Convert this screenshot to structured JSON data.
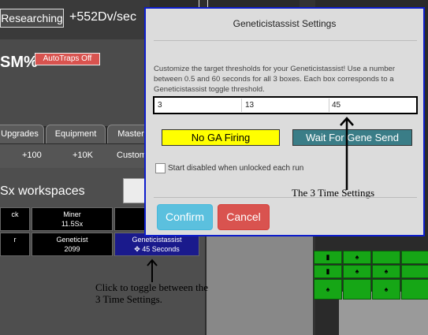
{
  "game": {
    "research_label": "Researching",
    "dv_rate": "+552Dv/sec",
    "sm_percent": "SM%",
    "autotraps_label": "AutoTraps Off",
    "tabs": [
      {
        "label": "Upgrades"
      },
      {
        "label": "Equipment"
      },
      {
        "label": "Master"
      }
    ],
    "buy_amounts": [
      {
        "label": "+100"
      },
      {
        "label": "+10K"
      },
      {
        "label": "Custom"
      }
    ],
    "workspace_title": "Sx workspaces",
    "jobs": [
      {
        "name": "ck",
        "value": ""
      },
      {
        "name": "Miner",
        "value": "11.5Sx"
      },
      {
        "name": "r",
        "value": ""
      },
      {
        "name": "Geneticist",
        "value": "2099"
      },
      {
        "name": "Geneticistassist",
        "value": "45 Seconds"
      }
    ],
    "green_cells": [
      "▮",
      "♠",
      "♠",
      "♠",
      "♠"
    ],
    "colors": {
      "accent": "#0d1dcc",
      "green": "#16a616",
      "selected_job": "#1a1a8c"
    }
  },
  "annotations": {
    "toggle_note": "Click to toggle between the 3 Time Settings.",
    "threshold_note": "The 3 Time Settings"
  },
  "modal": {
    "title": "Geneticistassist Settings",
    "description": "Customize the target thresholds for your Geneticistassist! Use a number between 0.5 and 60 seconds for all 3 boxes. Each box corresponds to a Geneticistassist toggle threshold.",
    "thresholds": [
      "3",
      "13",
      "45"
    ],
    "no_ga_label": "No GA Firing",
    "wait_label": "Wait For Gene Send",
    "start_disabled_label": "Start disabled when unlocked each run",
    "start_disabled_checked": false,
    "confirm_label": "Confirm",
    "cancel_label": "Cancel"
  }
}
